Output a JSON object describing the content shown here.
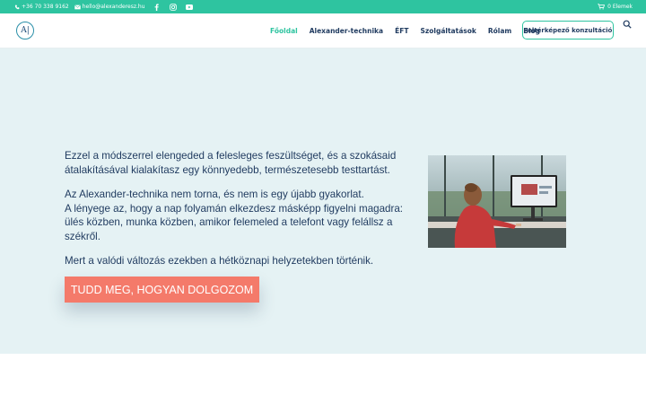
{
  "topbar": {
    "phone": "+36 70 338 9162",
    "email": "hello@alexanderesz.hu",
    "social": [
      "facebook-icon",
      "instagram-icon",
      "youtube-icon"
    ],
    "cart": "0 Elemek"
  },
  "header": {
    "logo_text": "A|",
    "nav": [
      "Főoldal",
      "Alexander-technika",
      "ÉFT",
      "Szolgáltatások",
      "Rólam",
      "Blog"
    ],
    "active_nav": "Főoldal",
    "cta": "Feltérképező konzultáció"
  },
  "hero": {
    "paragraph1": "Ezzel a módszerrel elengeded a felesleges feszültséget, és a szokásaid átalakításával kialakítasz egy könnyedebb, természetesebb testtartást.",
    "paragraph2_line1": "Az Alexander-technika nem torna, és nem is egy újabb gyakorlat.",
    "paragraph2_line2": "A lényege az, hogy a nap folyamán elkezdesz másképp figyelni magadra: ülés közben, munka közben, amikor felemeled a telefont vagy felállsz a székről.",
    "paragraph3": "Mert a valódi változás ezekben a hétköznapi helyzetekben történik.",
    "button": "TUDD MEG, HOGYAN DOLGOZOM"
  },
  "colors": {
    "accent": "#2ec4a0",
    "text": "#1f3a5f",
    "hero_bg": "#e5f2f4",
    "button": "#f47a6a"
  }
}
